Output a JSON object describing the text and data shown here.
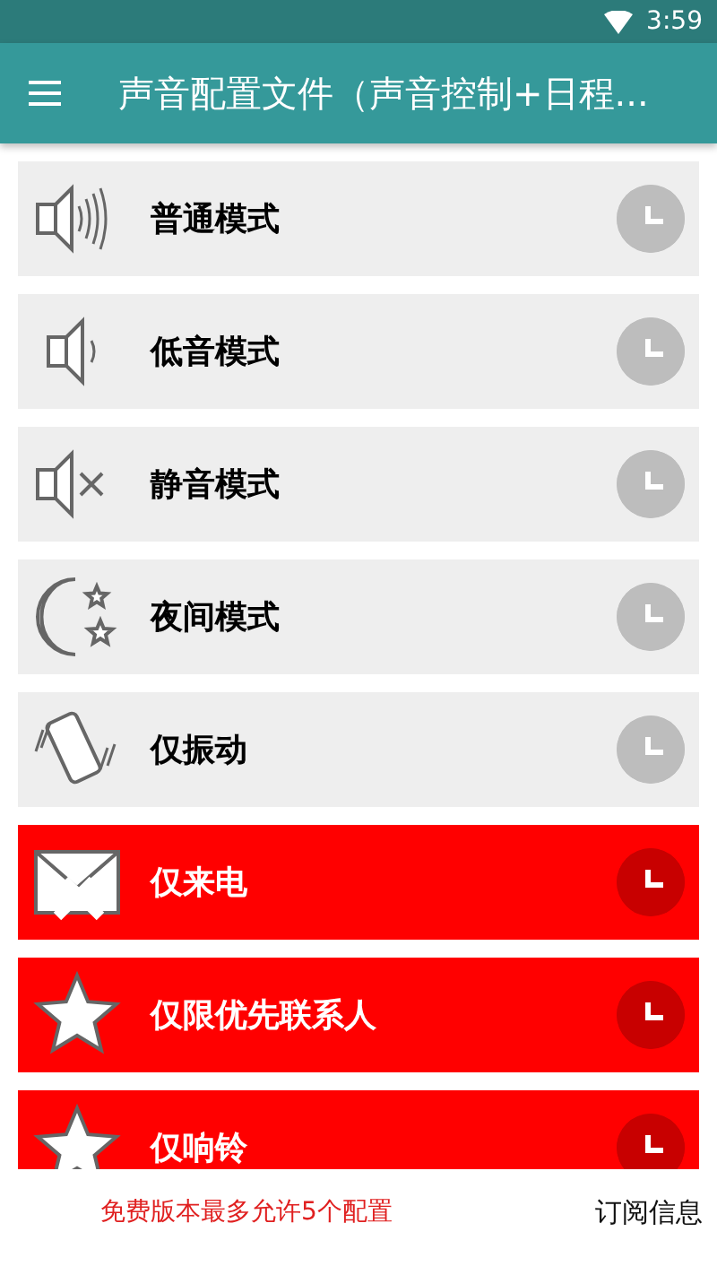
{
  "status_bar": {
    "time": "3:59"
  },
  "app_bar": {
    "title": "声音配置文件（声音控制+日程..."
  },
  "profiles": [
    {
      "label": "普通模式",
      "kind": "normal",
      "locked": false
    },
    {
      "label": "低音模式",
      "kind": "low",
      "locked": false
    },
    {
      "label": "静音模式",
      "kind": "silent",
      "locked": false
    },
    {
      "label": "夜间模式",
      "kind": "night",
      "locked": false
    },
    {
      "label": "仅振动",
      "kind": "vibrate",
      "locked": false
    },
    {
      "label": "仅来电",
      "kind": "calls",
      "locked": true
    },
    {
      "label": "仅限优先联系人",
      "kind": "priority",
      "locked": true
    },
    {
      "label": "仅响铃",
      "kind": "alarms",
      "locked": true
    }
  ],
  "footer": {
    "notice": "免费版本最多允许5个配置",
    "link": "订阅信息"
  }
}
